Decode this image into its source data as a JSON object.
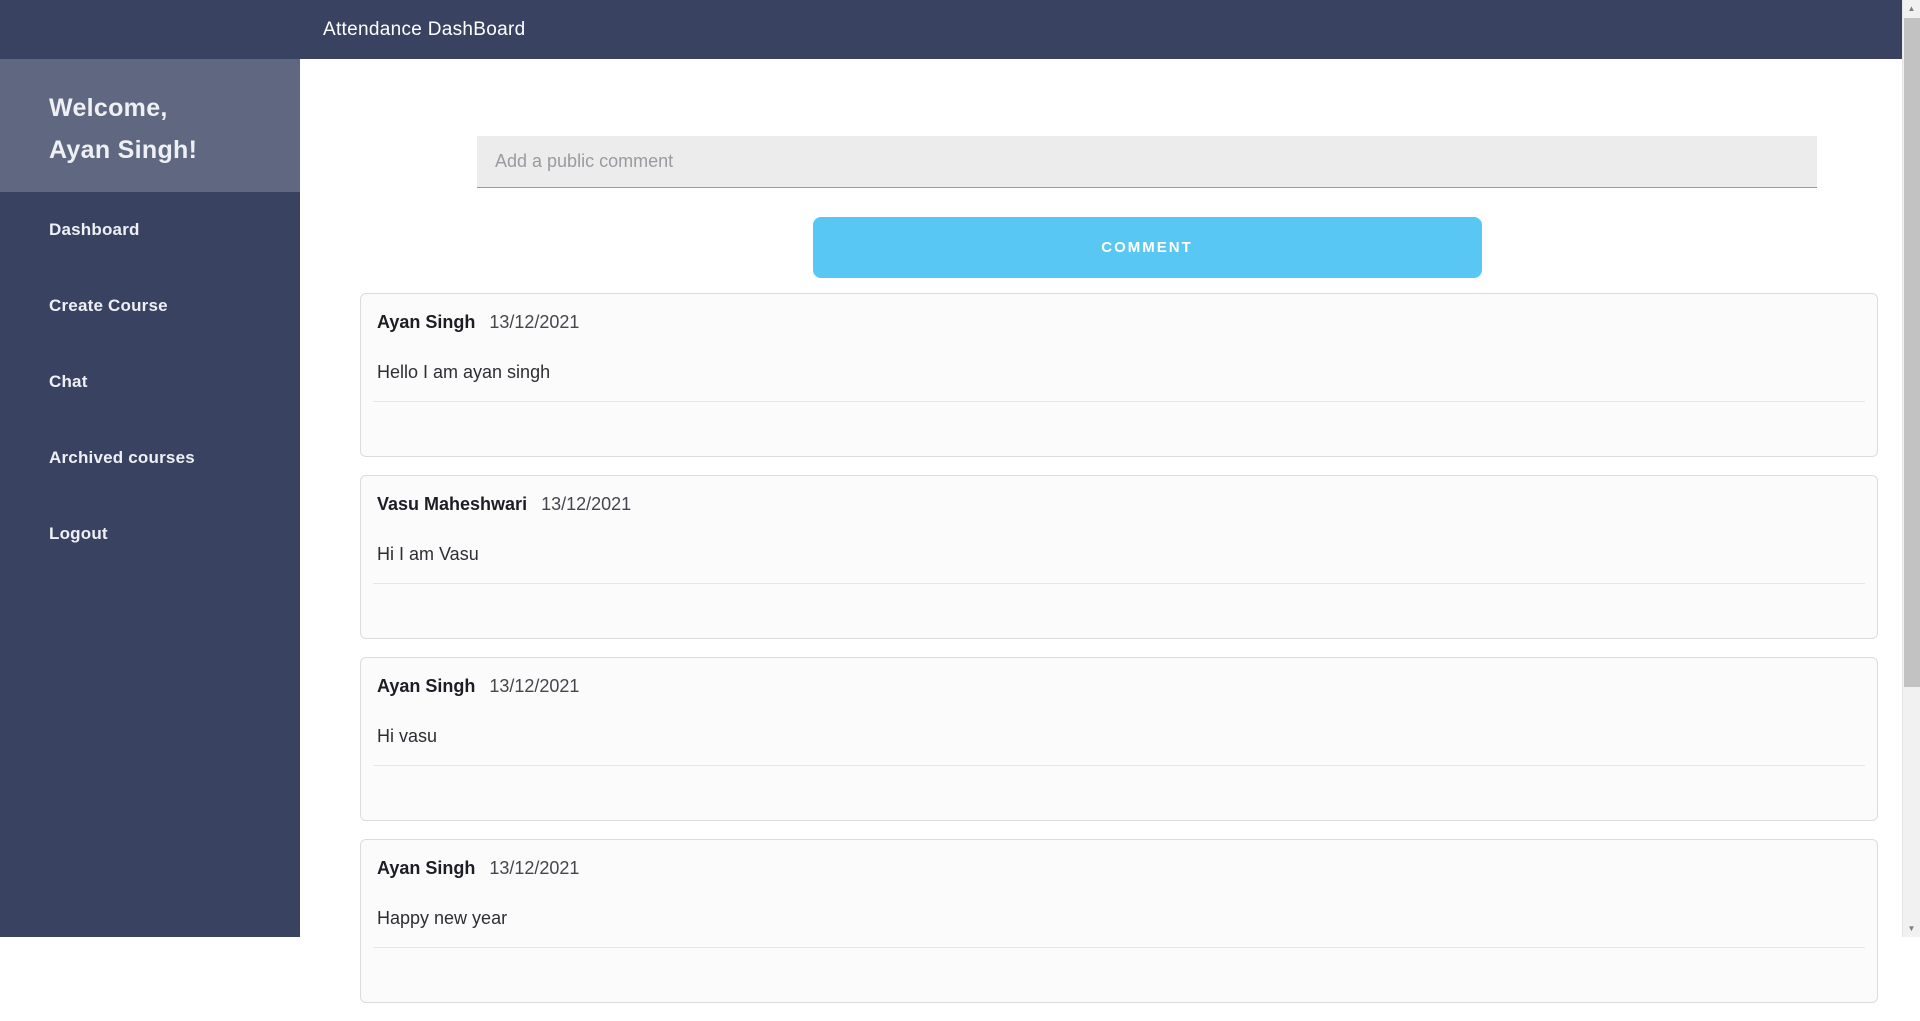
{
  "navbar": {
    "title": "Attendance DashBoard"
  },
  "sidebar": {
    "welcome_line1": "Welcome,",
    "welcome_line2": "Ayan Singh!",
    "items": [
      {
        "label": "Dashboard"
      },
      {
        "label": "Create Course"
      },
      {
        "label": "Chat"
      },
      {
        "label": "Archived courses"
      },
      {
        "label": "Logout"
      }
    ]
  },
  "comment_form": {
    "placeholder": "Add a public comment",
    "submit_label": "COMMENT"
  },
  "comments": [
    {
      "author": "Ayan Singh",
      "date": "13/12/2021",
      "text": "Hello I am ayan singh"
    },
    {
      "author": "Vasu Maheshwari",
      "date": "13/12/2021",
      "text": "Hi I am Vasu"
    },
    {
      "author": "Ayan Singh",
      "date": "13/12/2021",
      "text": "Hi vasu"
    },
    {
      "author": "Ayan Singh",
      "date": "13/12/2021",
      "text": "Happy new year"
    }
  ],
  "scrollbar": {
    "up_icon": "▲",
    "down_icon": "▼"
  },
  "colors": {
    "navbar_bg": "#3a4262",
    "welcome_bg": "#5f6880",
    "button_bg": "#59c7f4",
    "input_bg": "#ececec"
  }
}
